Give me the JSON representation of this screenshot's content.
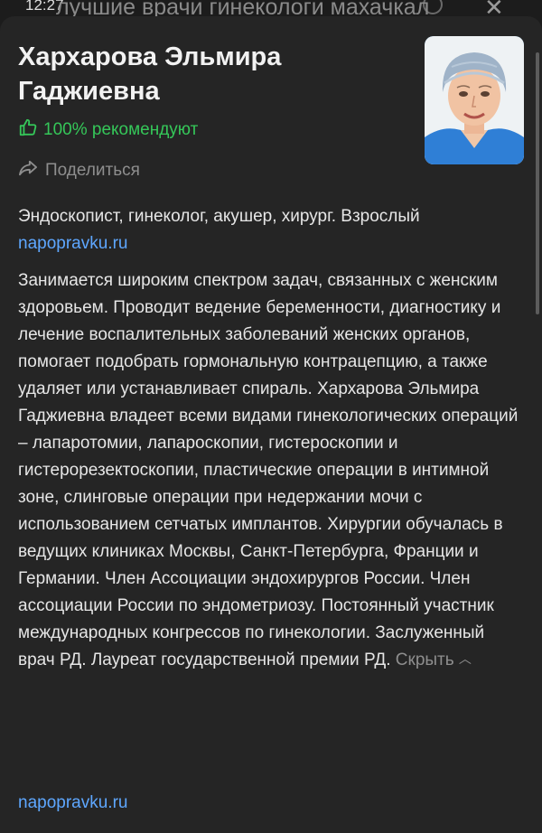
{
  "status": {
    "time": "12:27"
  },
  "search": {
    "query": "лучшие врачи гинекологи махачкал"
  },
  "doctor": {
    "name": "Хархарова Эльмира Гаджиевна",
    "recommend": "100% рекомендуют",
    "share": "Поделиться",
    "specialty": "Эндоскопист, гинеколог, акушер, хирург. Взрослый",
    "source": "napopravku.ru",
    "description": "Занимается широким спектром задач, связанных с женским здоровьем. Проводит ведение беременности, диагностику и лечение воспалительных заболеваний женских органов, помогает подобрать гормональную контрацепцию, а также удаляет или устанавливает спираль. Хархарова Эльмира Гаджиевна владеет всеми видами гинекологических операций – лапаротомии, лапароскопии, гистероскопии и гистерорезектоскопии, пластические операции в интимной зоне, слинговые операции при недержании мочи с использованием сетчатых имплантов. Хирургии обучалась в ведущих клиниках Москвы, Санкт-Петербурга, Франции и Германии. Член Ассоциации эндохирургов России. Член ассоциации России по эндометриозу. Постоянный участник международных конгрессов по гинекологии. Заслуженный врач РД. Лауреат государственной премии РД.",
    "hide": "Скрыть",
    "source_bottom": "napopravku.ru"
  },
  "colors": {
    "background": "#121212",
    "sheet": "#252525",
    "recommend": "#35c759",
    "link": "#5ea7ff",
    "muted": "#8e8e8e"
  },
  "icons": {
    "thumbs_up": "thumbs-up-icon",
    "share": "share-arrow-icon",
    "close": "close-icon",
    "chevron_up": "chevron-up-icon"
  }
}
